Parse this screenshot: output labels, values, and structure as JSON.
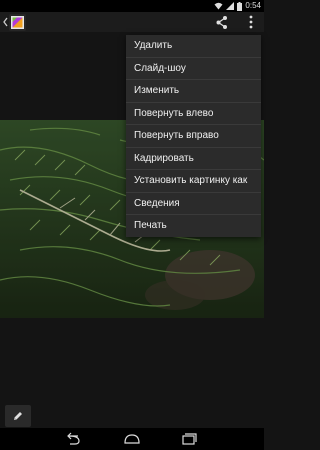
{
  "status_bar": {
    "time": "0:54",
    "icons": [
      "wifi-icon",
      "cellular-signal-icon",
      "battery-icon"
    ]
  },
  "action_bar": {
    "up_icon": "chevron-left-icon",
    "app_icon": "gallery-app-icon",
    "share_icon": "share-icon",
    "overflow_icon": "overflow-menu-icon"
  },
  "photo": {
    "subject": "juniper-branch-photo"
  },
  "menu": {
    "items": [
      {
        "label": "Удалить"
      },
      {
        "label": "Слайд-шоу"
      },
      {
        "label": "Изменить"
      },
      {
        "label": "Повернуть влево"
      },
      {
        "label": "Повернуть вправо"
      },
      {
        "label": "Кадрировать"
      },
      {
        "label": "Установить картинку как"
      },
      {
        "label": "Сведения"
      },
      {
        "label": "Печать"
      }
    ]
  },
  "edit": {
    "icon": "pencil-icon"
  },
  "nav_bar": {
    "back_icon": "back-icon",
    "home_icon": "home-icon",
    "recents_icon": "recents-icon"
  },
  "colors": {
    "menu_background": "#2b2b2b",
    "divider": "#3a3a3a",
    "foliage": "#3d5a2c"
  }
}
